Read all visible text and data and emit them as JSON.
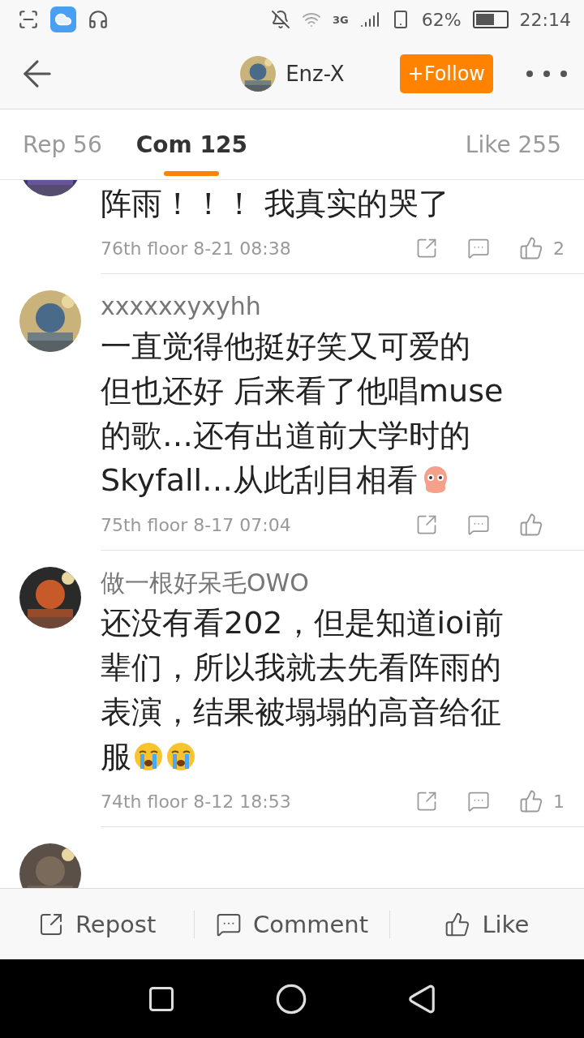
{
  "status_bar": {
    "battery_text": "62%",
    "time": "22:14",
    "network": "3G"
  },
  "header": {
    "user": "Enz-X",
    "follow": "+Follow"
  },
  "tabs": [
    {
      "label": "Rep 56",
      "selected": false
    },
    {
      "label": "Com 125",
      "selected": true
    },
    {
      "label": "Like 255",
      "selected": false
    }
  ],
  "comments": [
    {
      "kind": "cut_top",
      "lines": [
        "阵雨！！！ 我真实的哭了"
      ],
      "meta": "76th floor 8-21 08:38",
      "likes": "2"
    },
    {
      "kind": "full",
      "name": "xxxxxxyxyhh",
      "lines": [
        "一直觉得他挺好笑又可爱的",
        "但也还好 后来看了他唱muse",
        "的歌…还有出道前大学时的",
        "Skyfall…从此刮目相看"
      ],
      "emojis": [
        {
          "kind": "blob"
        }
      ],
      "meta": "75th floor 8-17 07:04"
    },
    {
      "kind": "full",
      "name": "做一根好呆毛OWO",
      "lines": [
        "还没有看202，但是知道ioi前",
        "辈们，所以我就去先看阵雨的",
        "表演，结果被塌塌的高音给征",
        "服"
      ],
      "emojis": [
        {
          "kind": "cry"
        },
        {
          "kind": "cry"
        }
      ],
      "meta": "74th floor 8-12 18:53",
      "likes": "1"
    },
    {
      "kind": "cut_bottom"
    }
  ],
  "bottom_bar": [
    "Repost",
    "Comment",
    "Like"
  ]
}
